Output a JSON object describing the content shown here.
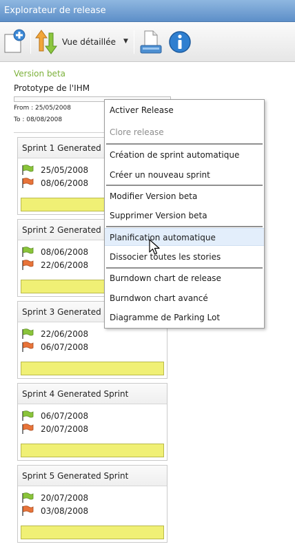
{
  "window": {
    "title": "Explorateur de release"
  },
  "toolbar": {
    "new_icon": "new-document-plus-icon",
    "view_icon": "up-down-arrows-icon",
    "view_label": "Vue détaillée",
    "print_icon": "printer-icon",
    "info_icon": "info-icon"
  },
  "release": {
    "name": "Version beta",
    "description": "Prototype de l'IHM",
    "from": "From : 25/05/2008",
    "to": "To : 08/08/2008"
  },
  "sprints": [
    {
      "title": "Sprint 1 Generated Sprint",
      "start": "25/05/2008",
      "end": "08/06/2008"
    },
    {
      "title": "Sprint 2 Generated Sprint",
      "start": "08/06/2008",
      "end": "22/06/2008"
    },
    {
      "title": "Sprint 3 Generated Sprint",
      "start": "22/06/2008",
      "end": "06/07/2008"
    },
    {
      "title": "Sprint 4 Generated Sprint",
      "start": "06/07/2008",
      "end": "20/07/2008"
    },
    {
      "title": "Sprint 5 Generated Sprint",
      "start": "20/07/2008",
      "end": "03/08/2008"
    }
  ],
  "context_menu": {
    "items": [
      {
        "label": "Activer Release"
      },
      {
        "label": "Clore release"
      },
      {
        "label": "Création de sprint automatique"
      },
      {
        "label": "Créer un nouveau sprint"
      },
      {
        "label": "Modifier Version beta"
      },
      {
        "label": "Supprimer Version beta"
      },
      {
        "label": "Planification automatique"
      },
      {
        "label": "Dissocier toutes les stories"
      },
      {
        "label": "Burndown chart de release"
      },
      {
        "label": "Burndwon chart avancé"
      },
      {
        "label": "Diagramme de Parking Lot"
      }
    ]
  },
  "colors": {
    "release_name": "#7cb13a",
    "sprint_bar": "#f0f075",
    "start_flag": "#8ac43a",
    "end_flag": "#e8743a",
    "menu_hover": "#e3eefb"
  }
}
